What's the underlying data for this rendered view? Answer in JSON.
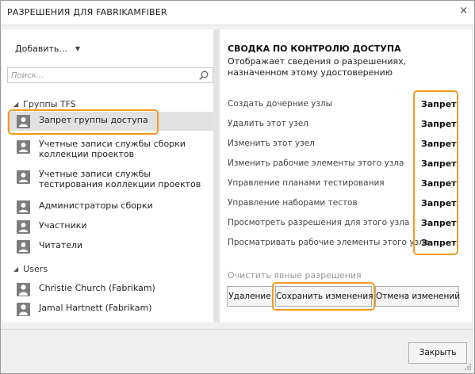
{
  "dialog": {
    "title": "РАЗРЕШЕНИЯ ДЛЯ FABRIKAMFIBER",
    "close_glyph": "×"
  },
  "left": {
    "add_label": "Добавить...",
    "add_caret": "▼",
    "search_placeholder": "Поиск...",
    "groups": [
      {
        "title": "Группы TFS",
        "expander": "◢",
        "items": [
          {
            "label": "Запрет группы доступа",
            "selected": true
          },
          {
            "label": "Учетные записи службы сборки коллекции проектов"
          },
          {
            "label": "Учетные записи службы тестирования коллекции проектов"
          },
          {
            "label": "Администраторы сборки"
          },
          {
            "label": "Участники"
          },
          {
            "label": "Читатели"
          }
        ]
      },
      {
        "title": "Users",
        "expander": "◢",
        "items": [
          {
            "label": "Christie Church (Fabrikam)"
          },
          {
            "label": "Jamal Hartnett (Fabrikam)"
          }
        ]
      }
    ]
  },
  "summary": {
    "title": "СВОДКА ПО КОНТРОЛЮ ДОСТУПА",
    "subtitle": "Отображает сведения о разрешениях, назначенном этому удостоверению",
    "permissions": [
      {
        "name": "Создать дочерние узлы",
        "value": "Запрет"
      },
      {
        "name": "Удалить этот узел",
        "value": "Запрет"
      },
      {
        "name": "Изменить этот узел",
        "value": "Запрет"
      },
      {
        "name": "Изменить рабочие элементы этого узла",
        "value": "Запрет"
      },
      {
        "name": "Управление планами тестирования",
        "value": "Запрет"
      },
      {
        "name": "Управление наборами тестов",
        "value": "Запрет"
      },
      {
        "name": "Просмотреть разрешения для этого узла",
        "value": "Запрет"
      },
      {
        "name": "Просматривать рабочие элементы этого узла",
        "value": "Запрет"
      }
    ],
    "clear_label": "Очистить явные разрешения",
    "buttons": {
      "delete": "Удаление",
      "save": "Сохранить изменения",
      "undo": "Отмена изменений"
    }
  },
  "footer": {
    "close_button": "Закрыть"
  },
  "colors": {
    "highlight": "#f39a1f",
    "selected_row": "#e1e1e1"
  }
}
